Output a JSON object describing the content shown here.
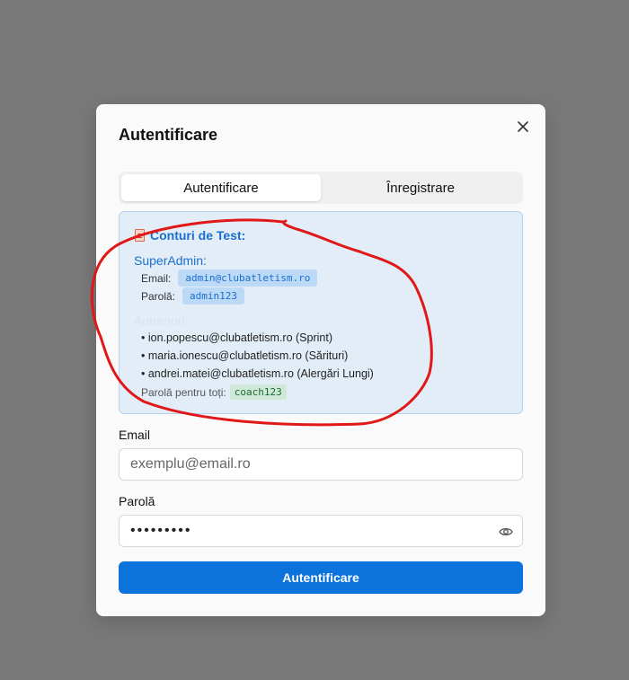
{
  "modal": {
    "title": "Autentificare",
    "close_icon": "close-icon"
  },
  "tabs": [
    {
      "label": "Autentificare",
      "active": true
    },
    {
      "label": "Înregistrare",
      "active": false
    }
  ],
  "test_accounts": {
    "icon": "document-icon",
    "title": "Conturi de Test:",
    "superadmin": {
      "heading": "SuperAdmin:",
      "email_label": "Email:",
      "email_value": "admin@clubatletism.ro",
      "password_label": "Parolă:",
      "password_value": "admin123"
    },
    "coaches": {
      "heading": "Antrenori:",
      "items": [
        "• ion.popescu@clubatletism.ro (Sprint)",
        "• maria.ionescu@clubatletism.ro (Sărituri)",
        "• andrei.matei@clubatletism.ro (Alergări Lungi)"
      ],
      "password_note": "Parolă pentru toți:",
      "password_value": "coach123"
    }
  },
  "form": {
    "email_label": "Email",
    "email_placeholder": "exemplu@email.ro",
    "password_label": "Parolă",
    "password_value": "•••••••••",
    "eye_icon": "eye-icon",
    "submit_label": "Autentificare"
  },
  "colors": {
    "accent": "#0d73dc",
    "annotation": "#e01818"
  }
}
